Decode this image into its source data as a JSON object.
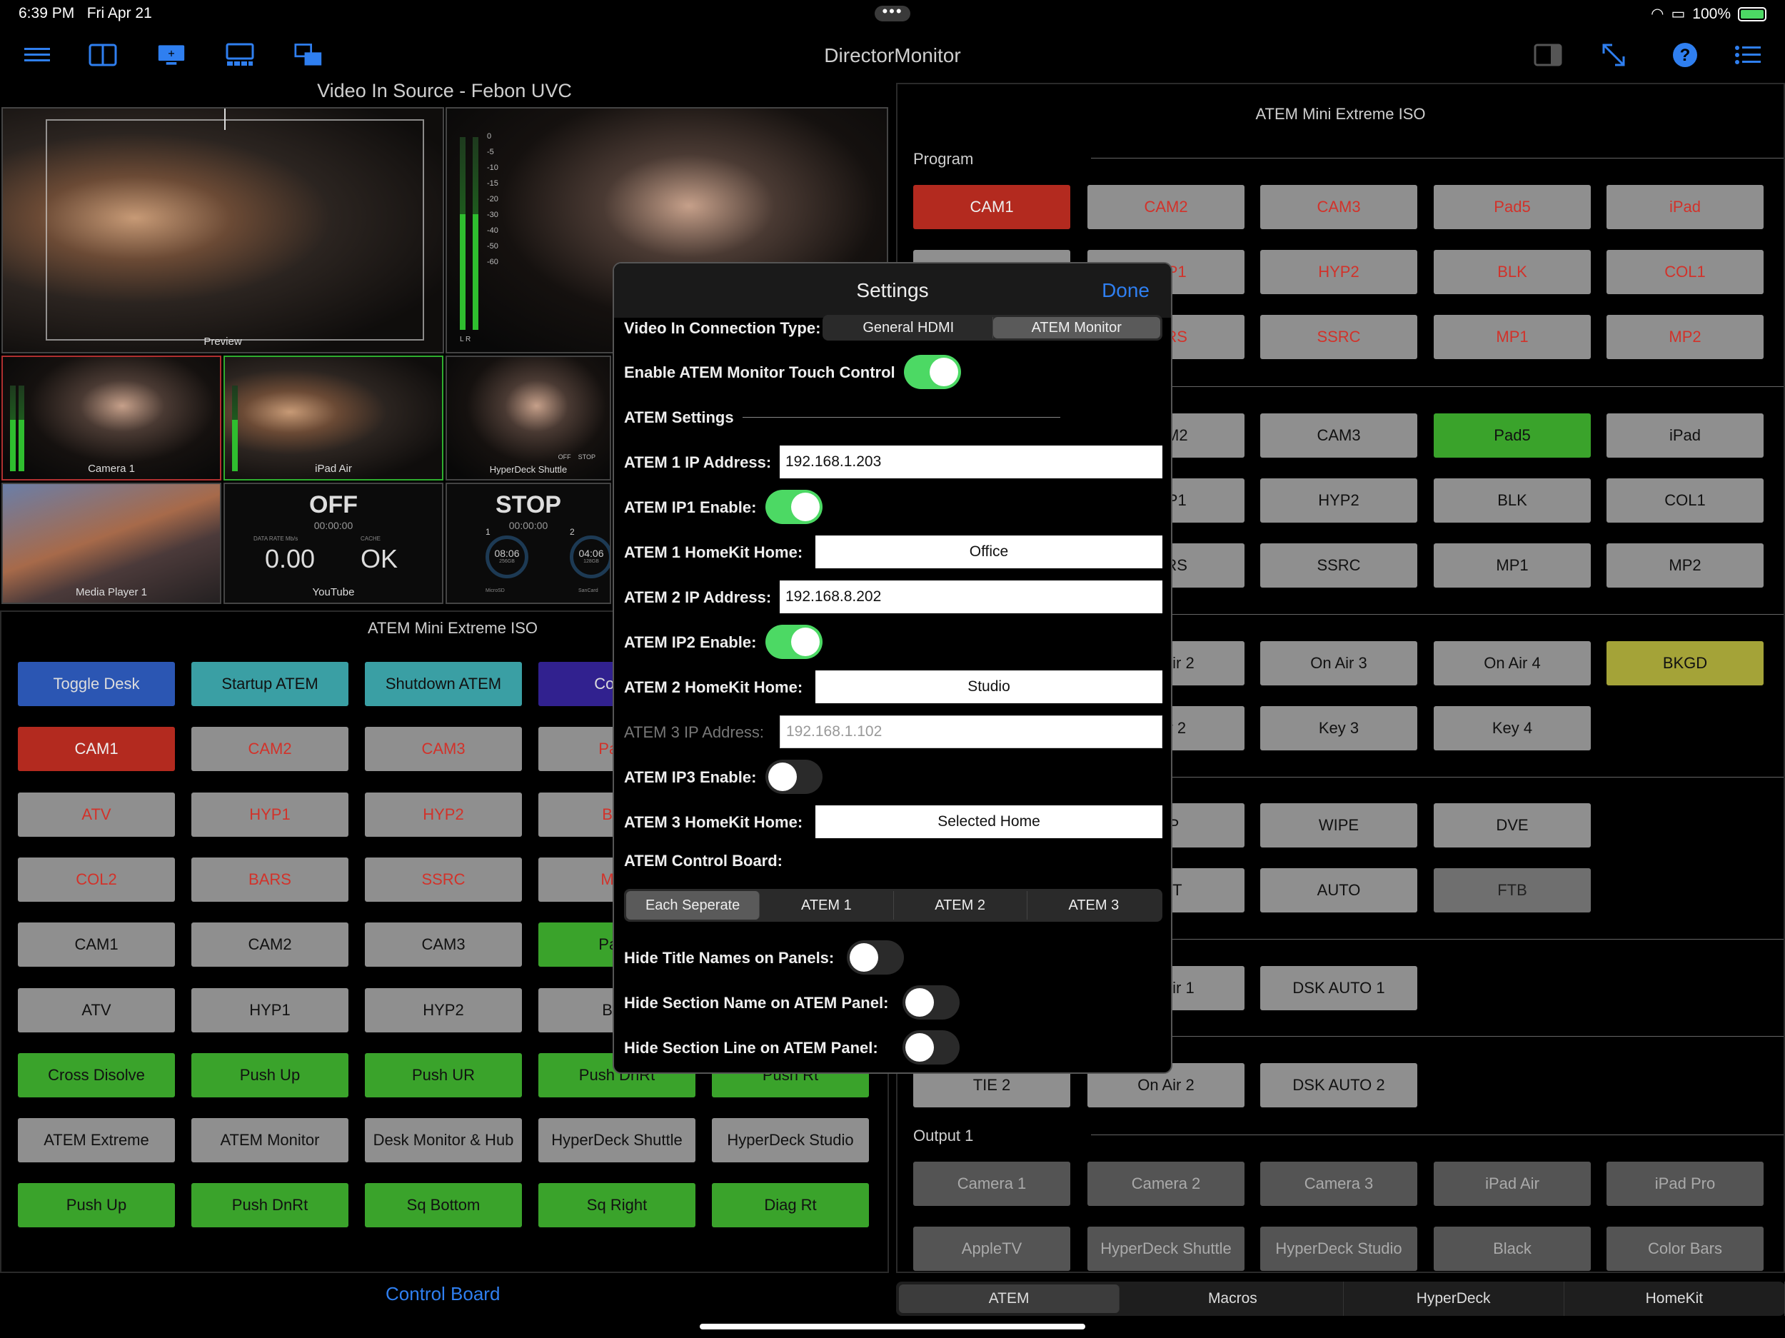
{
  "status": {
    "time": "6:39 PM",
    "date": "Fri Apr 21",
    "battery": "100%"
  },
  "toolbar": {
    "title": "DirectorMonitor",
    "icons": [
      "menu-icon",
      "split-view-icon",
      "monitor-add-icon",
      "multiview-icon",
      "window-arrange-icon",
      "sidebar-icon",
      "expand-icon",
      "help-icon",
      "list-icon"
    ]
  },
  "video": {
    "title": "Video In Source - Febon UVC",
    "preview_label": "Preview",
    "meter_ticks": [
      "0",
      "-5",
      "-10",
      "-15",
      "-20",
      "-30",
      "-40",
      "-50",
      "-60"
    ],
    "meter_lr": "L  R",
    "tiles": [
      "Camera 1",
      "iPad Air",
      "HyperDeck Shuttle",
      "Media Player 1",
      "YouTube"
    ],
    "hd_off": "OFF",
    "hd_stop": "STOP",
    "youtube_status": "OFF",
    "youtube_time": "00:00:00",
    "youtube_rate_label": "DATA RATE Mb/s",
    "youtube_rate": "0.00",
    "youtube_cache_label": "CACHE",
    "youtube_cache": "OK",
    "hyperdeck_status": "STOP",
    "hyperdeck_time": "00:00:00",
    "hd_slot1": "1",
    "hd_slot2": "2",
    "hd_disk1_time": "08:06",
    "hd_disk1_size": "256GB",
    "hd_disk1_name": "MicroSD",
    "hd_disk2_time": "04:06",
    "hd_disk2_size": "128GB",
    "hd_disk2_name": "SanCard"
  },
  "left_panel": {
    "title": "ATEM Mini Extreme ISO",
    "rows": [
      [
        {
          "l": "Toggle Desk",
          "c": "b-blue"
        },
        {
          "l": "Startup ATEM",
          "c": "b-teal"
        },
        {
          "l": "Shutdown ATEM",
          "c": "b-teal"
        },
        {
          "l": "Config",
          "c": "b-indigo"
        }
      ],
      [
        {
          "l": "CAM1",
          "c": "b-red"
        },
        {
          "l": "CAM2",
          "c": "b-gray-red"
        },
        {
          "l": "CAM3",
          "c": "b-gray-red"
        },
        {
          "l": "Pad5",
          "c": "b-gray-red"
        }
      ],
      [
        {
          "l": "ATV",
          "c": "b-gray-red"
        },
        {
          "l": "HYP1",
          "c": "b-gray-red"
        },
        {
          "l": "HYP2",
          "c": "b-gray-red"
        },
        {
          "l": "BLK",
          "c": "b-gray-red"
        }
      ],
      [
        {
          "l": "COL2",
          "c": "b-gray-red"
        },
        {
          "l": "BARS",
          "c": "b-gray-red"
        },
        {
          "l": "SSRC",
          "c": "b-gray-red"
        },
        {
          "l": "MP1",
          "c": "b-gray-red"
        }
      ],
      [
        {
          "l": "CAM1",
          "c": "b-gray"
        },
        {
          "l": "CAM2",
          "c": "b-gray"
        },
        {
          "l": "CAM3",
          "c": "b-gray"
        },
        {
          "l": "Pad5",
          "c": "b-green"
        }
      ],
      [
        {
          "l": "ATV",
          "c": "b-gray"
        },
        {
          "l": "HYP1",
          "c": "b-gray"
        },
        {
          "l": "HYP2",
          "c": "b-gray"
        },
        {
          "l": "BLK",
          "c": "b-gray"
        }
      ],
      [
        {
          "l": "Cross Disolve",
          "c": "b-green"
        },
        {
          "l": "Push Up",
          "c": "b-green"
        },
        {
          "l": "Push UR",
          "c": "b-green"
        },
        {
          "l": "Push DnRt",
          "c": "b-green"
        },
        {
          "l": "Push Rt",
          "c": "b-green"
        }
      ],
      [
        {
          "l": "ATEM Extreme",
          "c": "b-gray"
        },
        {
          "l": "ATEM Monitor",
          "c": "b-gray"
        },
        {
          "l": "Desk Monitor & Hub",
          "c": "b-gray"
        },
        {
          "l": "HyperDeck Shuttle",
          "c": "b-gray"
        },
        {
          "l": "HyperDeck Studio",
          "c": "b-gray"
        }
      ],
      [
        {
          "l": "Push Up",
          "c": "b-green"
        },
        {
          "l": "Push DnRt",
          "c": "b-green"
        },
        {
          "l": "Sq Bottom",
          "c": "b-green"
        },
        {
          "l": "Sq Right",
          "c": "b-green"
        },
        {
          "l": "Diag Rt",
          "c": "b-green"
        }
      ]
    ],
    "footer": "Control Board"
  },
  "right_panel": {
    "title": "ATEM Mini Extreme ISO",
    "program_label": "Program",
    "output_label": "Output 1",
    "rows": [
      [
        {
          "l": "CAM1",
          "c": "b-red"
        },
        {
          "l": "CAM2",
          "c": "b-gray-red"
        },
        {
          "l": "CAM3",
          "c": "b-gray-red"
        },
        {
          "l": "Pad5",
          "c": "b-gray-red"
        },
        {
          "l": "iPad",
          "c": "b-gray-red"
        }
      ],
      [
        {
          "l": "",
          "c": "b-gray-red"
        },
        {
          "l": "HYP1",
          "c": "b-gray-red"
        },
        {
          "l": "HYP2",
          "c": "b-gray-red"
        },
        {
          "l": "BLK",
          "c": "b-gray-red"
        },
        {
          "l": "COL1",
          "c": "b-gray-red"
        }
      ],
      [
        {
          "l": "",
          "c": "b-gray-red"
        },
        {
          "l": "BARS",
          "c": "b-gray-red"
        },
        {
          "l": "SSRC",
          "c": "b-gray-red"
        },
        {
          "l": "MP1",
          "c": "b-gray-red"
        },
        {
          "l": "MP2",
          "c": "b-gray-red"
        }
      ],
      [
        {
          "l": "",
          "c": "b-gray"
        },
        {
          "l": "CAM2",
          "c": "b-gray"
        },
        {
          "l": "CAM3",
          "c": "b-gray"
        },
        {
          "l": "Pad5",
          "c": "b-green"
        },
        {
          "l": "iPad",
          "c": "b-gray"
        }
      ],
      [
        {
          "l": "",
          "c": "b-gray"
        },
        {
          "l": "HYP1",
          "c": "b-gray"
        },
        {
          "l": "HYP2",
          "c": "b-gray"
        },
        {
          "l": "BLK",
          "c": "b-gray"
        },
        {
          "l": "COL1",
          "c": "b-gray"
        }
      ],
      [
        {
          "l": "",
          "c": "b-gray"
        },
        {
          "l": "BARS",
          "c": "b-gray"
        },
        {
          "l": "SSRC",
          "c": "b-gray"
        },
        {
          "l": "MP1",
          "c": "b-gray"
        },
        {
          "l": "MP2",
          "c": "b-gray"
        }
      ],
      [
        {
          "l": "",
          "c": "b-gray"
        },
        {
          "l": "On Air 2",
          "c": "b-gray"
        },
        {
          "l": "On Air 3",
          "c": "b-gray"
        },
        {
          "l": "On Air 4",
          "c": "b-gray"
        },
        {
          "l": "BKGD",
          "c": "b-yellow"
        }
      ],
      [
        {
          "l": "",
          "c": "b-gray"
        },
        {
          "l": "Key 2",
          "c": "b-gray"
        },
        {
          "l": "Key 3",
          "c": "b-gray"
        },
        {
          "l": "Key 4",
          "c": "b-gray"
        }
      ],
      [
        {
          "l": "",
          "c": "b-gray"
        },
        {
          "l": "DIP",
          "c": "b-gray"
        },
        {
          "l": "WIPE",
          "c": "b-gray"
        },
        {
          "l": "DVE",
          "c": "b-gray"
        }
      ],
      [
        {
          "l": "",
          "c": "b-gray"
        },
        {
          "l": "CUT",
          "c": "b-gray"
        },
        {
          "l": "AUTO",
          "c": "b-gray"
        },
        {
          "l": "FTB",
          "c": "b-dgray"
        }
      ],
      [
        {
          "l": "",
          "c": "b-gray"
        },
        {
          "l": "On Air 1",
          "c": "b-gray"
        },
        {
          "l": "DSK AUTO 1",
          "c": "b-gray"
        }
      ],
      [
        {
          "l": "TIE 2",
          "c": "b-gray"
        },
        {
          "l": "On Air 2",
          "c": "b-gray"
        },
        {
          "l": "DSK AUTO 2",
          "c": "b-gray"
        }
      ],
      [
        {
          "l": "Camera 1",
          "c": "b-dark"
        },
        {
          "l": "Camera 2",
          "c": "b-dark"
        },
        {
          "l": "Camera 3",
          "c": "b-dark"
        },
        {
          "l": "iPad Air",
          "c": "b-dark"
        },
        {
          "l": "iPad Pro",
          "c": "b-dark"
        }
      ],
      [
        {
          "l": "AppleTV",
          "c": "b-dark"
        },
        {
          "l": "HyperDeck Shuttle",
          "c": "b-dark"
        },
        {
          "l": "HyperDeck Studio",
          "c": "b-dark"
        },
        {
          "l": "Black",
          "c": "b-dark"
        },
        {
          "l": "Color Bars",
          "c": "b-dark"
        }
      ]
    ]
  },
  "tabs": [
    "ATEM",
    "Macros",
    "HyperDeck",
    "HomeKit"
  ],
  "settings": {
    "title": "Settings",
    "done": "Done",
    "conn_type_label": "Video In Connection Type:",
    "conn_options": [
      "General HDMI",
      "ATEM Monitor"
    ],
    "touch_control_label": "Enable ATEM Monitor Touch Control",
    "atem_settings_label": "ATEM Settings",
    "atem1_ip_label": "ATEM 1 IP Address:",
    "atem1_ip": "192.168.1.203",
    "atem1_enable_label": "ATEM IP1 Enable:",
    "atem1_home_label": "ATEM 1 HomeKit Home:",
    "atem1_home": "Office",
    "atem2_ip_label": "ATEM 2 IP Address:",
    "atem2_ip": "192.168.8.202",
    "atem2_enable_label": "ATEM IP2 Enable:",
    "atem2_home_label": "ATEM 2 HomeKit Home:",
    "atem2_home": "Studio",
    "atem3_ip_label": "ATEM 3 IP Address:",
    "atem3_ip_placeholder": "192.168.1.102",
    "atem3_enable_label": "ATEM IP3 Enable:",
    "atem3_home_label": "ATEM 3 HomeKit Home:",
    "atem3_home": "Selected Home",
    "control_board_label": "ATEM Control Board:",
    "control_board_options": [
      "Each Seperate",
      "ATEM 1",
      "ATEM 2",
      "ATEM 3"
    ],
    "hide_titles_label": "Hide Title Names on Panels:",
    "hide_section_name_label": "Hide Section Name on ATEM Panel:",
    "hide_section_line_label": "Hide Section Line on ATEM Panel:"
  }
}
